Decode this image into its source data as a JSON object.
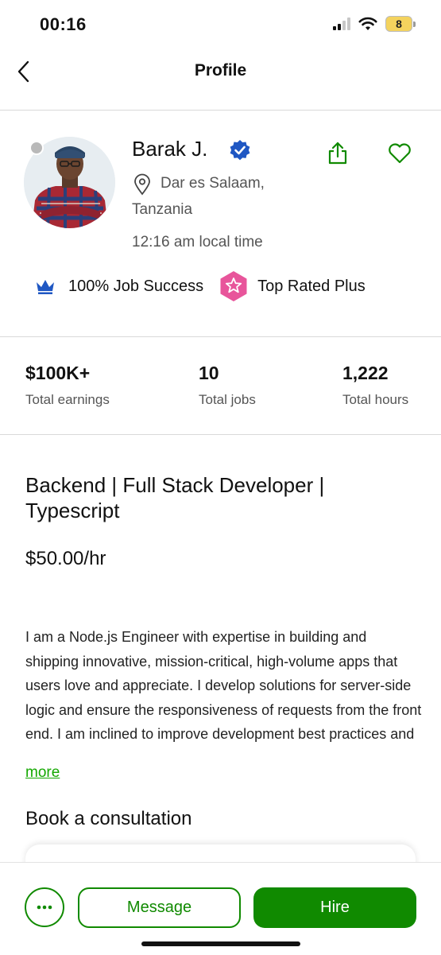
{
  "status_bar": {
    "time": "00:16",
    "battery": "8"
  },
  "nav": {
    "title": "Profile"
  },
  "profile": {
    "name": "Barak J.",
    "location_line1": "Dar es Salaam,",
    "location_line2": "Tanzania",
    "local_time": "12:16 am local time",
    "job_success": "100% Job Success",
    "badge": "Top Rated Plus"
  },
  "stats": [
    {
      "value": "$100K+",
      "label": "Total earnings"
    },
    {
      "value": "10",
      "label": "Total jobs"
    },
    {
      "value": "1,222",
      "label": "Total hours"
    }
  ],
  "headline": "Backend | Full Stack Developer | Typescript",
  "rate": "$50.00/hr",
  "description": "I am a Node.js Engineer with expertise in building and shipping innovative, mission-critical, high-volume apps that users love and appreciate. I develop solutions for server-side logic and ensure the responsiveness of requests from the front end. I am inclined to improve development best practices and",
  "more_link": "more",
  "book_section": "Book a consultation",
  "actions": {
    "message": "Message",
    "hire": "Hire"
  },
  "colors": {
    "accent": "#108a00",
    "verified": "#1f57c3",
    "top_rated_plus": "#e8559b",
    "crown": "#1f57c3"
  },
  "icons": [
    "back-chevron-icon",
    "verified-icon",
    "share-icon",
    "heart-icon",
    "location-pin-icon",
    "crown-icon",
    "top-rated-plus-icon",
    "more-dots-icon"
  ]
}
